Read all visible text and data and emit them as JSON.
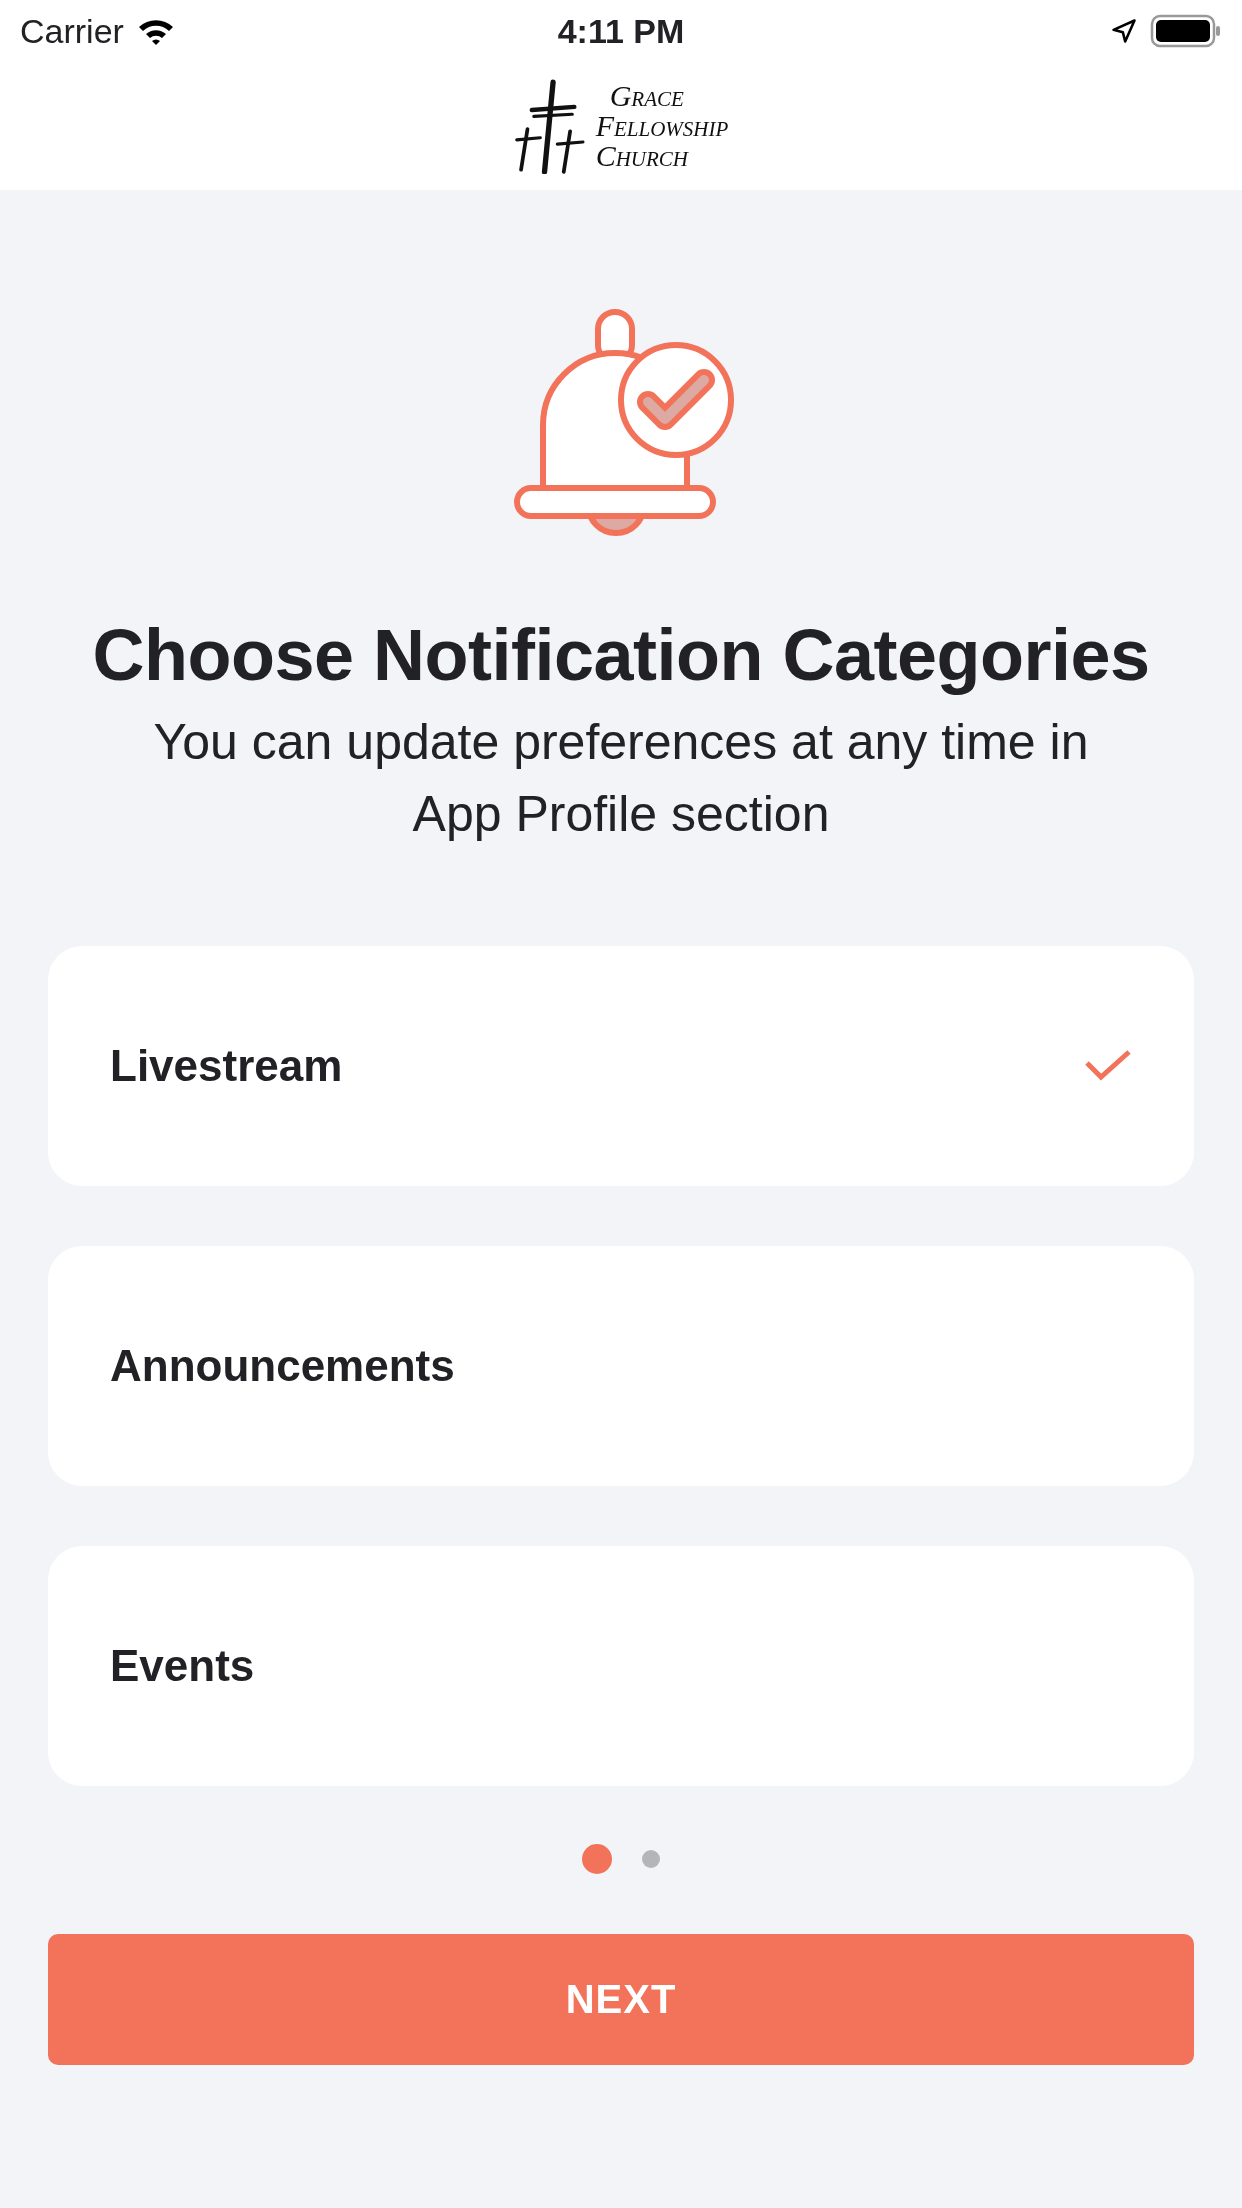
{
  "status_bar": {
    "carrier": "Carrier",
    "time": "4:11 PM"
  },
  "header": {
    "logo_lines": [
      "Grace",
      "Fellowship",
      "Church"
    ]
  },
  "title": "Choose Notification Categories",
  "subtitle": "You can update preferences at any time in App Profile section",
  "categories": [
    {
      "label": "Livestream",
      "selected": true
    },
    {
      "label": "Announcements",
      "selected": false
    },
    {
      "label": "Events",
      "selected": false
    }
  ],
  "pages": [
    {
      "selected": true
    },
    {
      "selected": false
    }
  ],
  "next_button": "NEXT"
}
